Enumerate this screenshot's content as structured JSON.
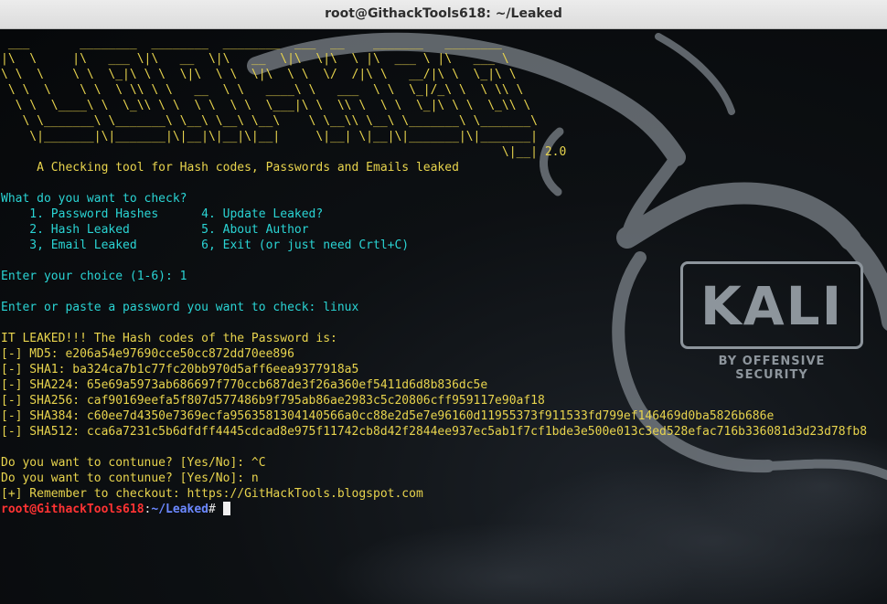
{
  "window": {
    "title": "root@GithackTools618: ~/Leaked"
  },
  "logo": {
    "word": "KALI",
    "tagline": "BY OFFENSIVE SECURITY"
  },
  "banner": {
    "art": [
      " ___       ________  ________  ________  ___  __    _______   ________",
      "|\\  \\     |\\   ___ \\|\\   __  \\|\\   __  \\|\\  \\|\\  \\ |\\  ___ \\ |\\   ___ \\",
      "\\ \\  \\    \\ \\  \\_|\\ \\ \\  \\|\\  \\ \\  \\|\\  \\ \\  \\/  /|\\ \\   __/|\\ \\  \\_|\\ \\",
      " \\ \\  \\    \\ \\  \\ \\\\ \\ \\   __  \\ \\   ____\\ \\   ___  \\ \\  \\_|/_\\ \\  \\ \\\\ \\",
      "  \\ \\  \\____\\ \\  \\_\\\\ \\ \\  \\ \\  \\ \\  \\___|\\ \\  \\\\ \\  \\ \\  \\_|\\ \\ \\  \\_\\\\ \\",
      "   \\ \\_______\\ \\_______\\ \\__\\ \\__\\ \\__\\    \\ \\__\\\\ \\__\\ \\_______\\ \\_______\\",
      "    \\|_______|\\|_______|\\|__|\\|__|\\|__|     \\|__| \\|__|\\|_______|\\|_______|",
      "                                                                      \\|__| 2.0"
    ],
    "tagline": "     A Checking tool for Hash codes, Passwords and Emails leaked"
  },
  "menu": {
    "question": "What do you want to check?",
    "rows": [
      "    1. Password Hashes      4. Update Leaked?",
      "    2. Hash Leaked          5. About Author",
      "    3, Email Leaked         6, Exit (or just need Crtl+C)"
    ]
  },
  "session": {
    "choice_prompt": "Enter your choice (1-6): 1",
    "password_prompt": "Enter or paste a password you want to check: linux",
    "leak_header": "IT LEAKED!!! The Hash codes of the Password is:",
    "hashes": [
      "[-] MD5: e206a54e97690cce50cc872dd70ee896",
      "[-] SHA1: ba324ca7b1c77fc20bb970d5aff6eea9377918a5",
      "[-] SHA224: 65e69a5973ab686697f770ccb687de3f26a360ef5411d6d8b836dc5e",
      "[-] SHA256: caf90169eefa5f807d577486b9f795ab86ae2983c5c20806cff959117e90af18",
      "[-] SHA384: c60ee7d4350e7369ecfa9563581304140566a0cc88e2d5e7e96160d11955373f911533fd799ef146469d0ba5826b686e",
      "[-] SHA512: cca6a7231c5b6dfdff4445cdcad8e975f11742cb8d42f2844ee937ec5ab1f7cf1bde3e500e013c3ed528efac716b336081d3d23d78fb8"
    ],
    "continue_1": "Do you want to contunue? [Yes/No]: ^C",
    "continue_2": "Do you want to contunue? [Yes/No]: n",
    "remember": "[+] Remember to checkout: https://GitHackTools.blogspot.com"
  },
  "prompt": {
    "user_host": "root@GithackTools618",
    "sep": ":",
    "path": "~/Leaked",
    "symbol": "#"
  },
  "colors": {
    "accent_yellow": "#e8d44d",
    "accent_cyan": "#2ad4d4",
    "prompt_red": "#ff3333",
    "prompt_blue": "#6b88ff"
  }
}
